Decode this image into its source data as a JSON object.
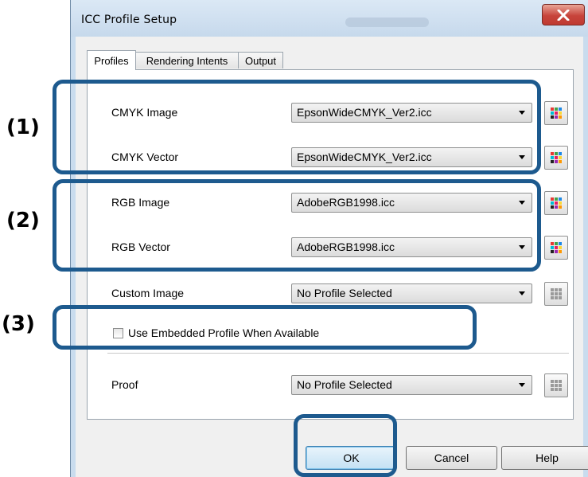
{
  "window": {
    "title": "ICC Profile Setup",
    "close_icon": "close-icon"
  },
  "tabs": [
    {
      "label": "Profiles",
      "active": true
    },
    {
      "label": "Rendering Intents",
      "active": false
    },
    {
      "label": "Output",
      "active": false
    }
  ],
  "rows": {
    "cmyk_image": {
      "label": "CMYK Image",
      "value": "EpsonWideCMYK_Ver2.icc"
    },
    "cmyk_vector": {
      "label": "CMYK Vector",
      "value": "EpsonWideCMYK_Ver2.icc"
    },
    "rgb_image": {
      "label": "RGB Image",
      "value": "AdobeRGB1998.icc"
    },
    "rgb_vector": {
      "label": "RGB Vector",
      "value": "AdobeRGB1998.icc"
    },
    "custom_image": {
      "label": "Custom Image",
      "value": "No Profile Selected"
    },
    "proof": {
      "label": "Proof",
      "value": "No Profile Selected"
    }
  },
  "embedded_checkbox": {
    "label": "Use Embedded Profile When Available",
    "checked": false
  },
  "buttons": {
    "ok": "OK",
    "cancel": "Cancel",
    "help": "Help"
  },
  "markers": {
    "m1": "(1)",
    "m2": "(2)",
    "m3": "(3)"
  },
  "colors": {
    "highlight": "#1d5a8e",
    "title_close": "#c7443b"
  }
}
